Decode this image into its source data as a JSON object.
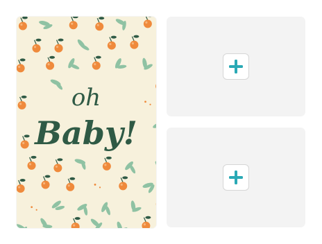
{
  "card": {
    "greeting_line1": "oh",
    "greeting_line2": "Baby!",
    "icon": "oranges-pattern-illustration",
    "colors": {
      "background": "#f7f1dc",
      "fruit": "#ef8a3c",
      "leaf": "#8fc2a3",
      "stem": "#2f5a45",
      "lettering": "#2f5a45"
    }
  },
  "slots": [
    {
      "action": "add",
      "icon": "plus-icon",
      "accent": "#2aa9b5"
    },
    {
      "action": "add",
      "icon": "plus-icon",
      "accent": "#2aa9b5"
    }
  ]
}
